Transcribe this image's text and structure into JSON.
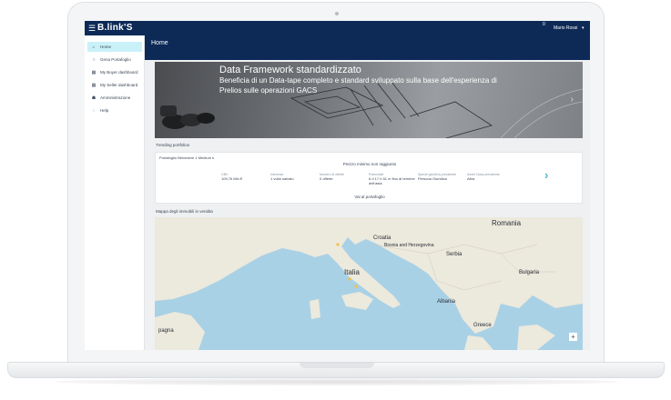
{
  "topbar": {
    "logo": "B.link'S",
    "notifications": "0",
    "user": "Mario Rossi"
  },
  "sidebar": {
    "items": [
      {
        "label": "Home",
        "icon": "home-icon",
        "glyph": "⌂"
      },
      {
        "label": "Gena Portafoglio",
        "icon": "circle-icon",
        "glyph": "○"
      },
      {
        "label": "My Buyer dashboard",
        "icon": "grid-icon",
        "glyph": "▦"
      },
      {
        "label": "My Seller dashboard",
        "icon": "grid-icon",
        "glyph": "▦"
      },
      {
        "label": "Amministrazione",
        "icon": "users-icon",
        "glyph": "☗"
      },
      {
        "label": "Help",
        "icon": "help-icon",
        "glyph": "◌"
      }
    ]
  },
  "page": {
    "title": "Home"
  },
  "hero": {
    "title": "Data Framework standardizzato",
    "text": "Beneficia di un Data-tape completo e standard sviluppato sulla base dell'esperienza di Prelios sulle operazioni GACS"
  },
  "trending": {
    "label": "Trending portfolios",
    "portfolio_name": "Portafoglio Belvedere 1 Medium s",
    "min_price_label": "Prezzo minimo non raggiunto",
    "metrics": [
      {
        "label": "GBV",
        "value": "109,76 Mln €"
      },
      {
        "label": "Interesse",
        "value": "1 volta salvato"
      },
      {
        "label": "Numero di offerte",
        "value": "0 offerte"
      },
      {
        "label": "Potenziale",
        "value": "6 d 17 h 51 m fino al termine dell'asta"
      },
      {
        "label": "Specie giuridica prevalente",
        "value": "Persona Giuridica"
      },
      {
        "label": "Asset Class prevalente",
        "value": "Altra"
      }
    ],
    "link": "Vai al portafoglio"
  },
  "map": {
    "label": "Mappa degli immobili in vendita",
    "places": [
      {
        "name": "Romania"
      },
      {
        "name": "Croatia"
      },
      {
        "name": "Serbia"
      },
      {
        "name": "Bosnia and Herzegovina"
      },
      {
        "name": "Italia"
      },
      {
        "name": "Albania"
      },
      {
        "name": "Bulgaria"
      },
      {
        "name": "Greece"
      },
      {
        "name": "pagna"
      }
    ]
  },
  "colors": {
    "navy": "#0d2a57",
    "active": "#c9f1f8",
    "accent": "#4bb8d3",
    "sea": "#a9d1e6",
    "land": "#ece9dd"
  }
}
